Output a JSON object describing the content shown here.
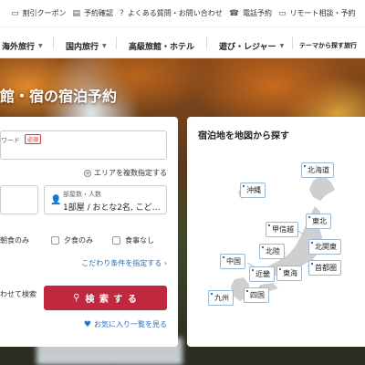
{
  "topbar": {
    "items": [
      {
        "icon": "coupon-icon",
        "label": "割引クーポン"
      },
      {
        "icon": "document-icon",
        "label": "予約確認"
      },
      {
        "icon": "question-icon",
        "label": "よくある質問・お問い合わせ"
      },
      {
        "icon": "phone-icon",
        "label": "電話予約"
      },
      {
        "icon": "monitor-icon",
        "label": "リモート相談・予約"
      }
    ]
  },
  "nav": {
    "items": [
      {
        "label": "海外旅行",
        "has_dropdown": true
      },
      {
        "label": "国内旅行",
        "has_dropdown": true
      },
      {
        "label": "高級旅館・ホテル",
        "has_dropdown": false
      },
      {
        "label": "遊び・レジャー",
        "has_dropdown": true
      },
      {
        "label": "テーマから探す旅行",
        "has_dropdown": false
      }
    ]
  },
  "hero": {
    "title": "館・宿の宿泊予約"
  },
  "search": {
    "keyword_label": "ワード",
    "required_badge": "必須",
    "multi_area_link": "エリアを複数指定する",
    "guests_label": "部屋数・人数",
    "guests_value": "1部屋 / おとな2名, こど…",
    "meals": [
      "朝食のみ",
      "夕食のみ",
      "食事なし"
    ],
    "conditions_link": "こだわり条件を指定する ›",
    "combo_text": "わせて検索",
    "search_button": "検 索 す る",
    "favorites_link": "お気に入り一覧を見る"
  },
  "map": {
    "title": "宿泊地を地図から探す",
    "regions": [
      "北海道",
      "沖縄",
      "東北",
      "甲信越",
      "北関東",
      "北陸",
      "中国",
      "首都圏",
      "東海",
      "近畿",
      "九州",
      "四国"
    ]
  },
  "colors": {
    "accent": "#c0283f",
    "link": "#2a6fb8",
    "region_border": "#9bb8d6"
  }
}
